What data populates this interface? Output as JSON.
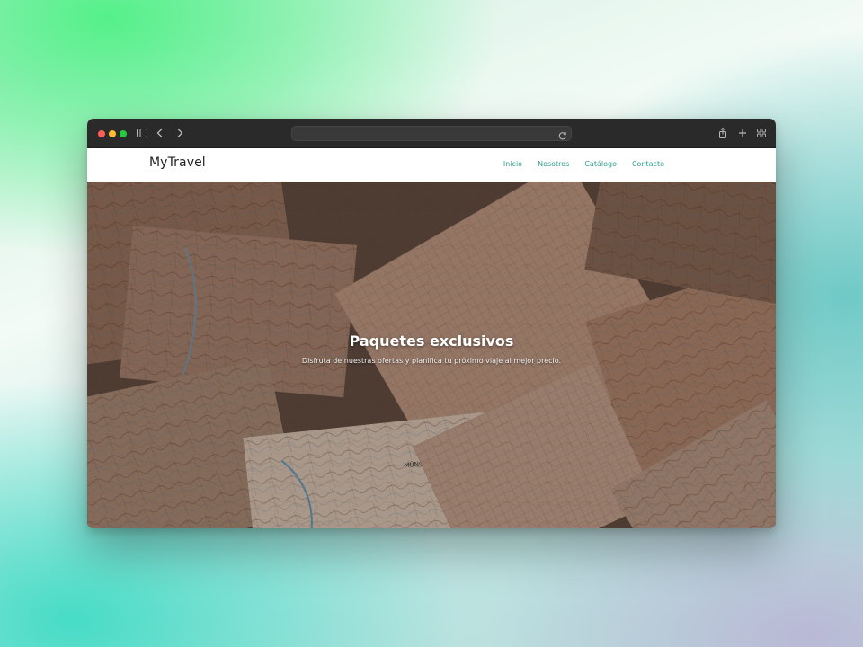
{
  "browser": {
    "address_bar_value": "",
    "icons": [
      "sidebar-icon",
      "back-icon",
      "forward-icon",
      "reload-icon",
      "share-icon",
      "new-tab-icon",
      "tab-overview-icon"
    ]
  },
  "site": {
    "brand": "MyTravel",
    "nav": [
      "Inicio",
      "Nosotros",
      "Catálogo",
      "Contacto"
    ],
    "accent_color": "#2e9e88"
  },
  "hero": {
    "title": "Paquetes exclusivos",
    "subtitle": "Disfruta de nuestras ofertas y planifica tu próximo viaje al mejor precio.",
    "map_label": "MÜNC"
  }
}
